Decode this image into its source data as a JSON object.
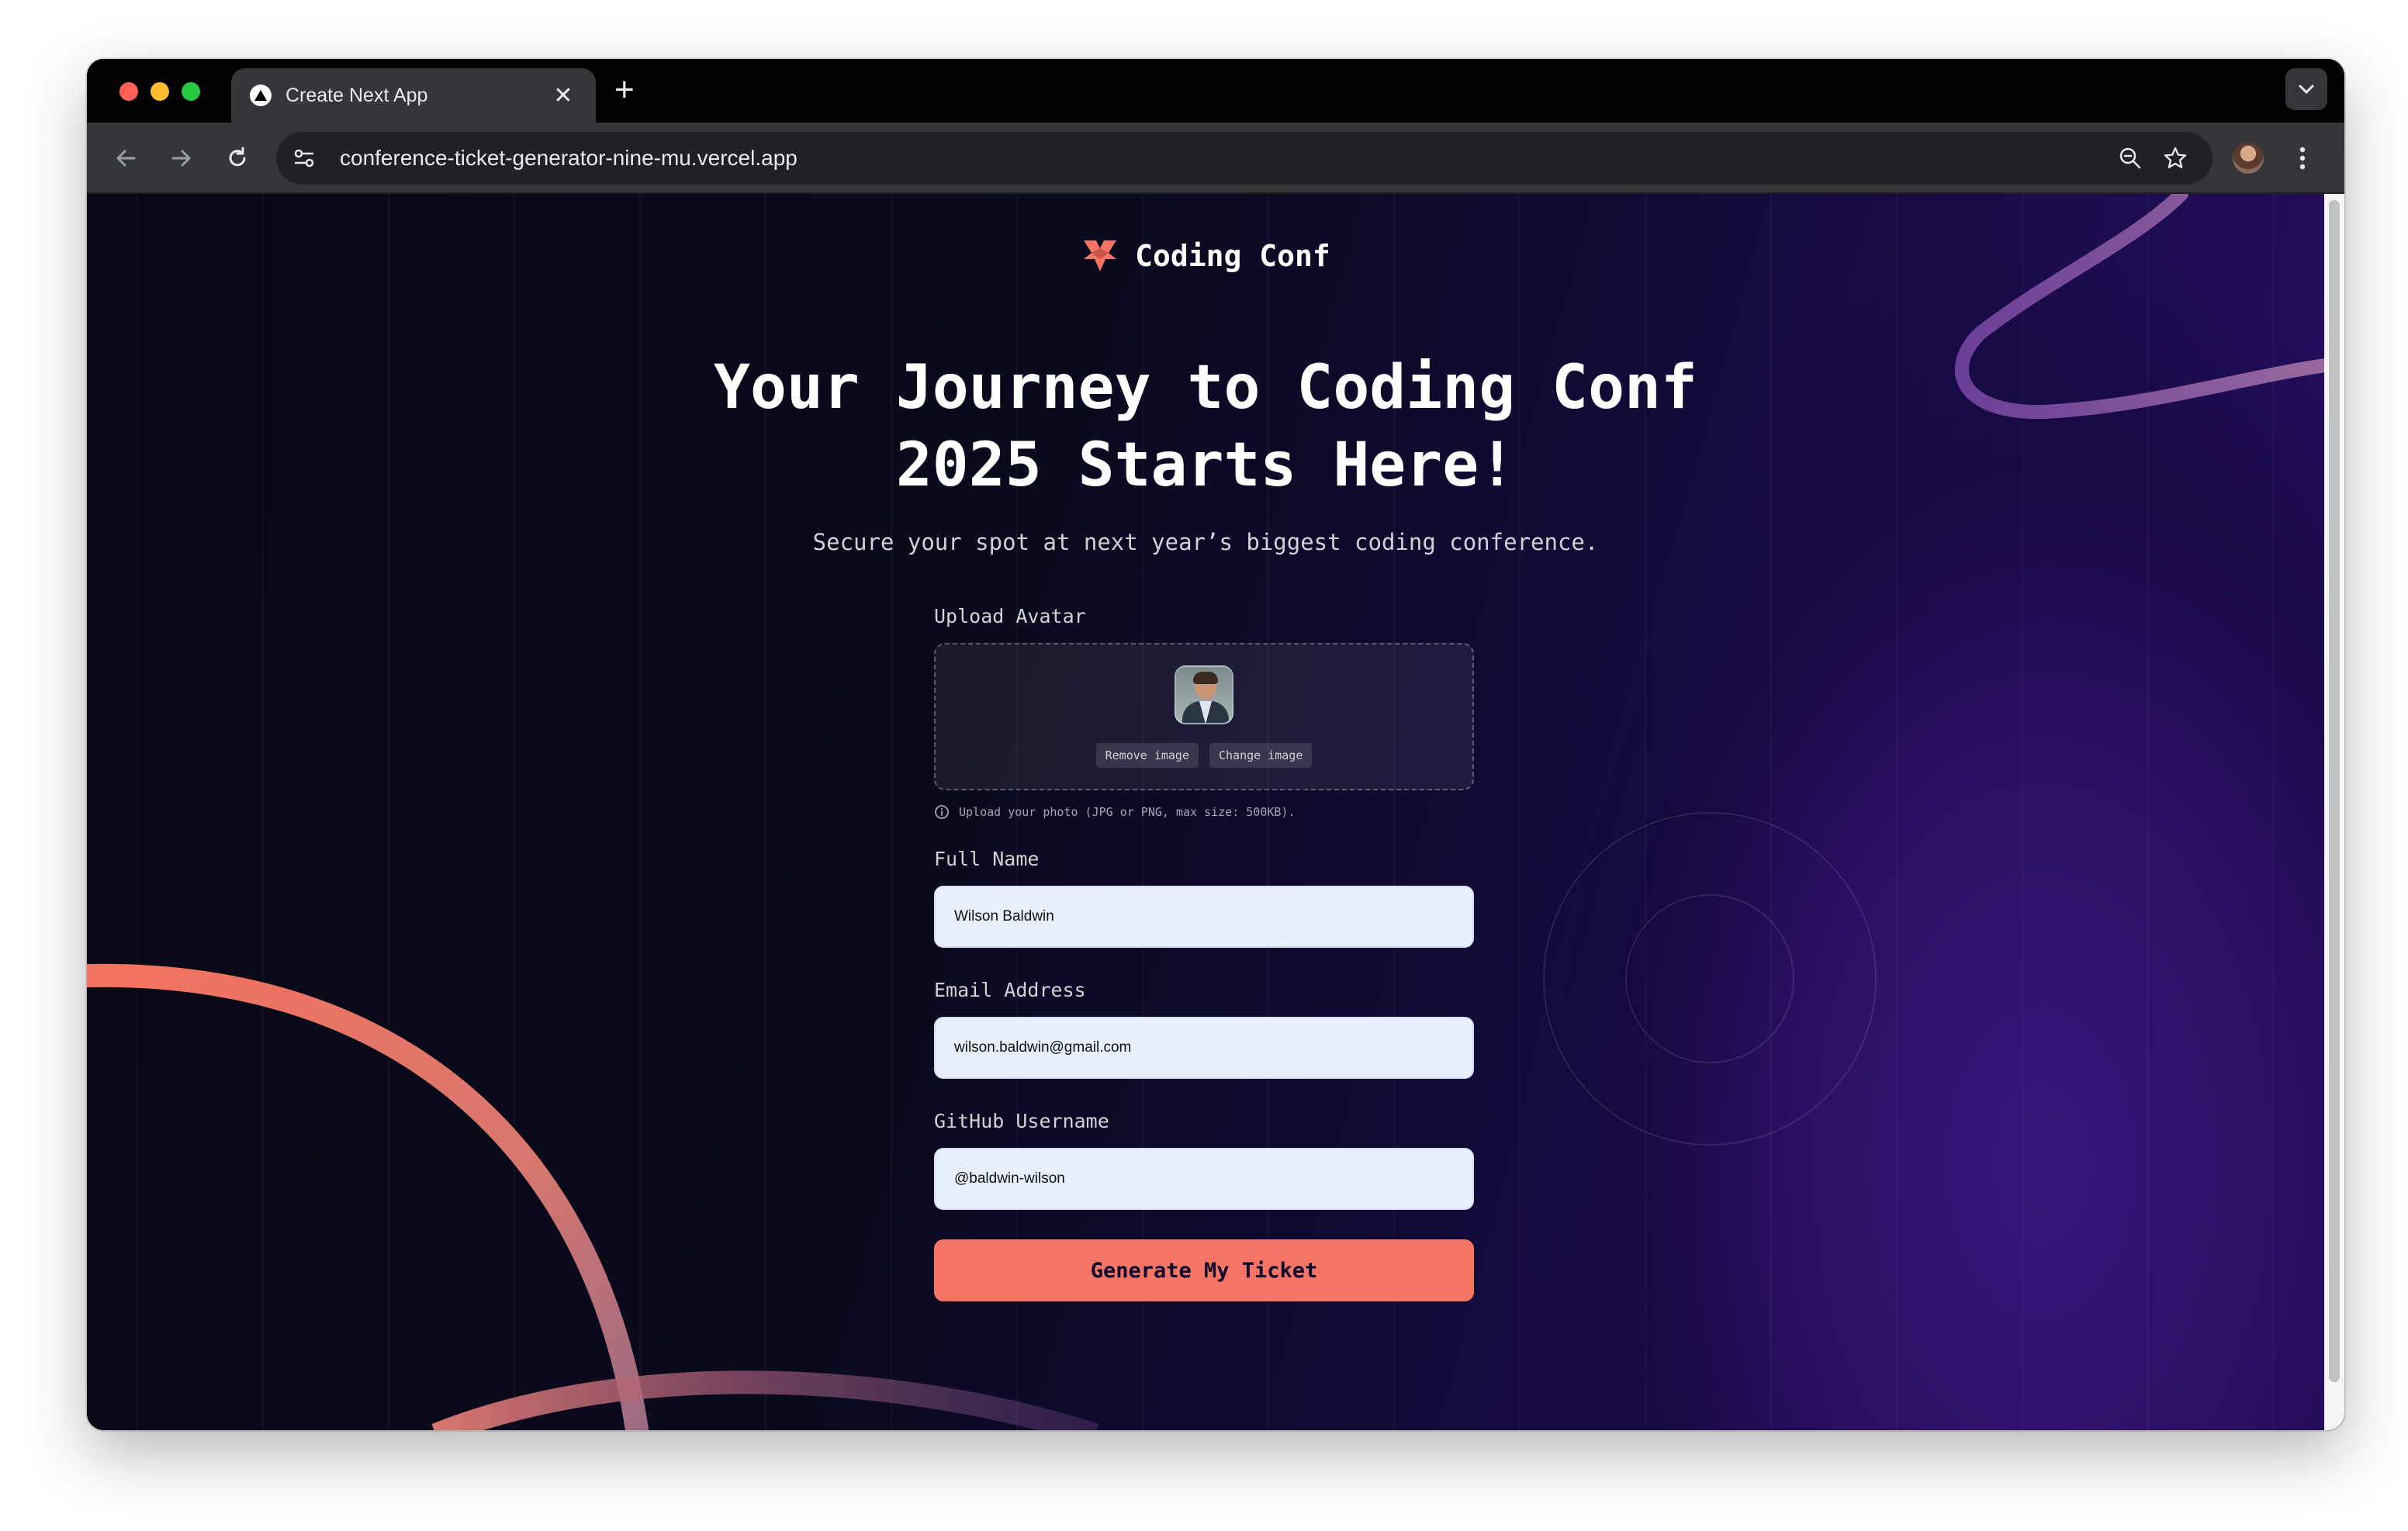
{
  "browser": {
    "tab_title": "Create Next App",
    "url": "conference-ticket-generator-nine-mu.vercel.app"
  },
  "icons": {
    "logo": "coding-conf-logo-icon",
    "info": "info-circle-icon",
    "favicon": "triangle-icon"
  },
  "colors": {
    "accent": "#f57463",
    "input_bg": "#e8effd",
    "bg_dark": "#0a0a1e",
    "bg_purple": "#2a0e66"
  },
  "page": {
    "brand_name": "Coding Conf",
    "headline_line1": "Your Journey to Coding Conf",
    "headline_line2": "2025 Starts Here!",
    "subheadline": "Secure your spot at next year’s biggest coding conference."
  },
  "form": {
    "avatar_label": "Upload Avatar",
    "remove_image_label": "Remove image",
    "change_image_label": "Change image",
    "upload_hint": "Upload your photo (JPG or PNG, max size: 500KB).",
    "full_name_label": "Full Name",
    "full_name_value": "Wilson Baldwin",
    "email_label": "Email Address",
    "email_value": "wilson.baldwin@gmail.com",
    "github_label": "GitHub Username",
    "github_value": "@baldwin-wilson",
    "submit_label": "Generate My Ticket"
  }
}
